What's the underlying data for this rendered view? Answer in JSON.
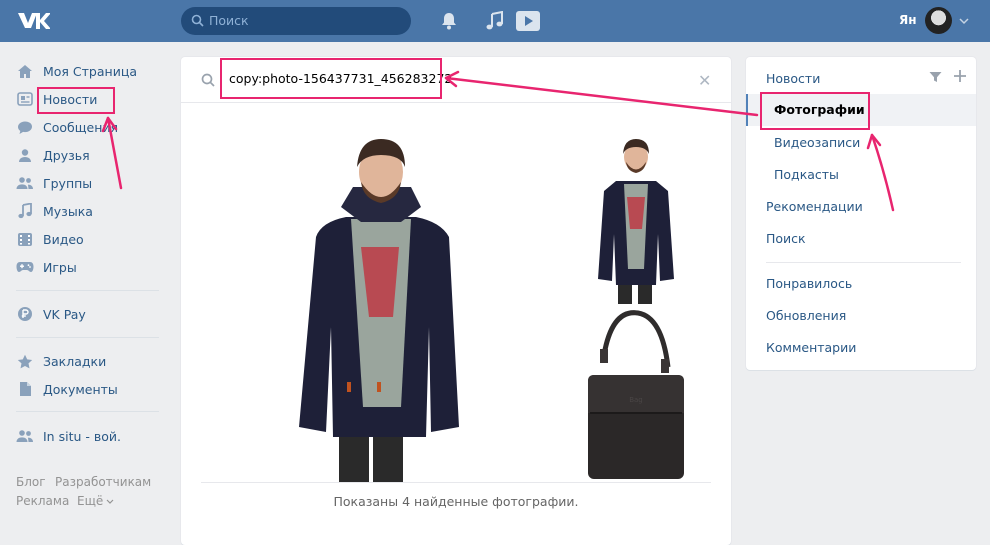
{
  "header": {
    "search_placeholder": "Поиск",
    "user_name": "Ян"
  },
  "sidebar": {
    "items": [
      {
        "label": "Моя Страница",
        "icon": "home-icon"
      },
      {
        "label": "Новости",
        "icon": "news-icon"
      },
      {
        "label": "Сообщения",
        "icon": "messages-icon"
      },
      {
        "label": "Друзья",
        "icon": "friends-icon"
      },
      {
        "label": "Группы",
        "icon": "groups-icon"
      },
      {
        "label": "Музыка",
        "icon": "music-icon"
      },
      {
        "label": "Видео",
        "icon": "video-icon"
      },
      {
        "label": "Игры",
        "icon": "games-icon"
      },
      {
        "label": "VK Pay",
        "icon": "vkpay-icon"
      },
      {
        "label": "Закладки",
        "icon": "bookmarks-icon"
      },
      {
        "label": "Документы",
        "icon": "documents-icon"
      },
      {
        "label": "In situ - вой.",
        "icon": "group-icon"
      }
    ],
    "footer": {
      "blog": "Блог",
      "developers": "Разработчикам",
      "ads": "Реклама",
      "more": "Ещё"
    }
  },
  "main": {
    "query": "copy:photo-156437731_456283272",
    "results_text": "Показаны 4 найденные фотографии."
  },
  "right_menu": {
    "news": "Новости",
    "photos": "Фотографии",
    "videos": "Видеозаписи",
    "podcasts": "Подкасты",
    "recommendations": "Рекомендации",
    "search": "Поиск",
    "liked": "Понравилось",
    "updates": "Обновления",
    "comments": "Комментарии"
  },
  "colors": {
    "header": "#4a76a8",
    "link": "#2a5885",
    "highlight": "#e8256f"
  }
}
